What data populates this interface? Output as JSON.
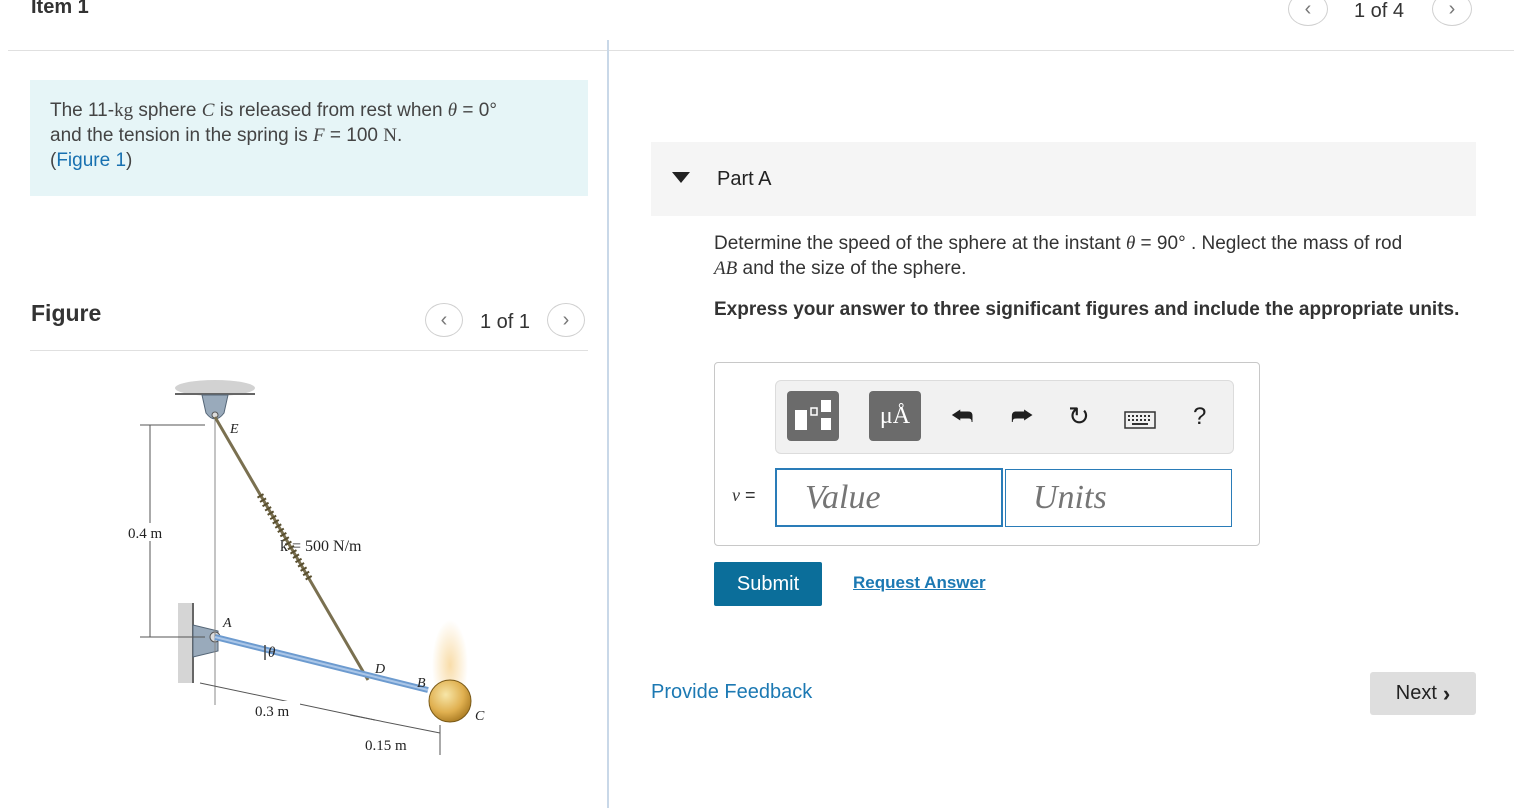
{
  "header": {
    "item_title": "Item 1",
    "pager_text": "1 of 4"
  },
  "problem": {
    "line1_pre": "The 11-",
    "line1_unit": "kg",
    "line1_mid": " sphere ",
    "line1_var": "C",
    "line1_post": " is released from rest when ",
    "theta": "θ",
    "line1_end": " = 0°",
    "line2_pre": "and the tension in the spring is ",
    "line2_var": "F",
    "line2_mid": " = 100 ",
    "line2_unit": "N",
    "line2_end": ".",
    "figure_link": "Figure 1"
  },
  "figure": {
    "label": "Figure",
    "pager_text": "1 of 1",
    "labels": {
      "E": "E",
      "A": "A",
      "B": "B",
      "C": "C",
      "D": "D",
      "theta": "θ",
      "height": "0.4 m",
      "k": "k = 500 N/m",
      "len_ad": "0.3 m",
      "len_db": "0.15 m"
    }
  },
  "partA": {
    "title": "Part A",
    "question_pre": "Determine the speed of the sphere at the instant ",
    "theta": "θ",
    "question_mid": " = 90°",
    "question_post": "  . Neglect the mass of rod",
    "question_var": "AB",
    "question_end": " and the size of the sphere.",
    "instruction": "Express your answer to three significant figures and include the appropriate units.",
    "toolbar": {
      "template_icon": "fraction-template-icon",
      "units_label": "μÅ",
      "undo_icon": "undo-icon",
      "redo_icon": "redo-icon",
      "reset_icon": "reset-icon",
      "keyboard_icon": "keyboard-icon",
      "help_label": "?"
    },
    "var_label": "v",
    "var_eq": " =",
    "value_placeholder": "Value",
    "units_placeholder": "Units",
    "submit_label": "Submit",
    "request_answer_label": "Request Answer"
  },
  "footer": {
    "feedback_label": "Provide Feedback",
    "next_label": "Next"
  },
  "colors": {
    "accent": "#0b6e9a",
    "link": "#1c79b3",
    "problem_bg": "#e6f5f7"
  }
}
